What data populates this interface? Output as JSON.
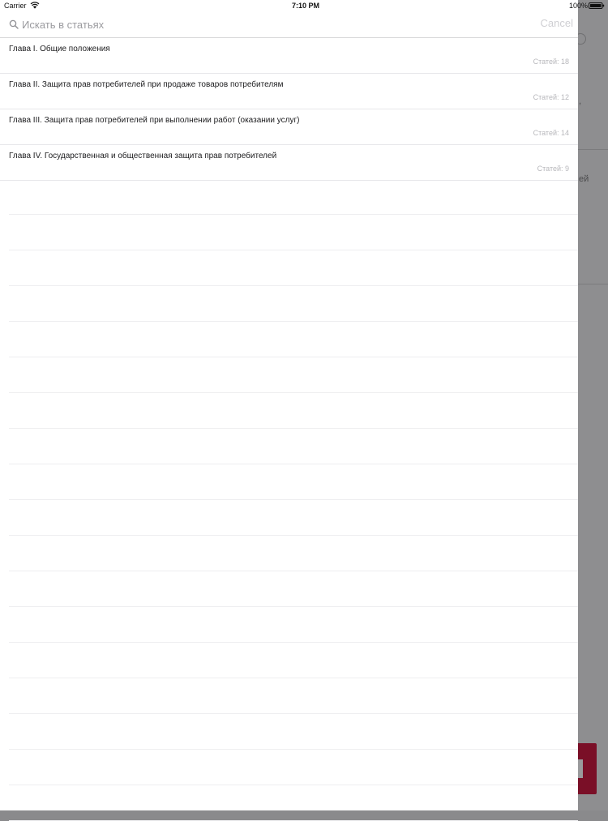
{
  "status_bar": {
    "carrier": "Carrier",
    "time": "7:10 PM",
    "battery": "100%"
  },
  "search": {
    "placeholder": "Искать в статьях",
    "value": "",
    "cancel_label": "Cancel"
  },
  "chapters": [
    {
      "title": "Глава I. Общие положения",
      "count": "Статей: 18"
    },
    {
      "title": "Глава II. Защита прав потребителей при продаже товаров потребителям",
      "count": "Статей: 12"
    },
    {
      "title": "Глава III. Защита прав потребителей при выполнении работ (оказании услуг)",
      "count": "Статей: 14"
    },
    {
      "title": "Глава IV. Государственная и общественная защита прав потребителей",
      "count": "Статей: 9"
    }
  ],
  "background": {
    "fragments": [
      ",",
      "ей"
    ]
  },
  "colors": {
    "accent_dark_red": "#7a0f27",
    "separator": "#e7e7ea",
    "secondary_text": "#b7b7bb"
  }
}
